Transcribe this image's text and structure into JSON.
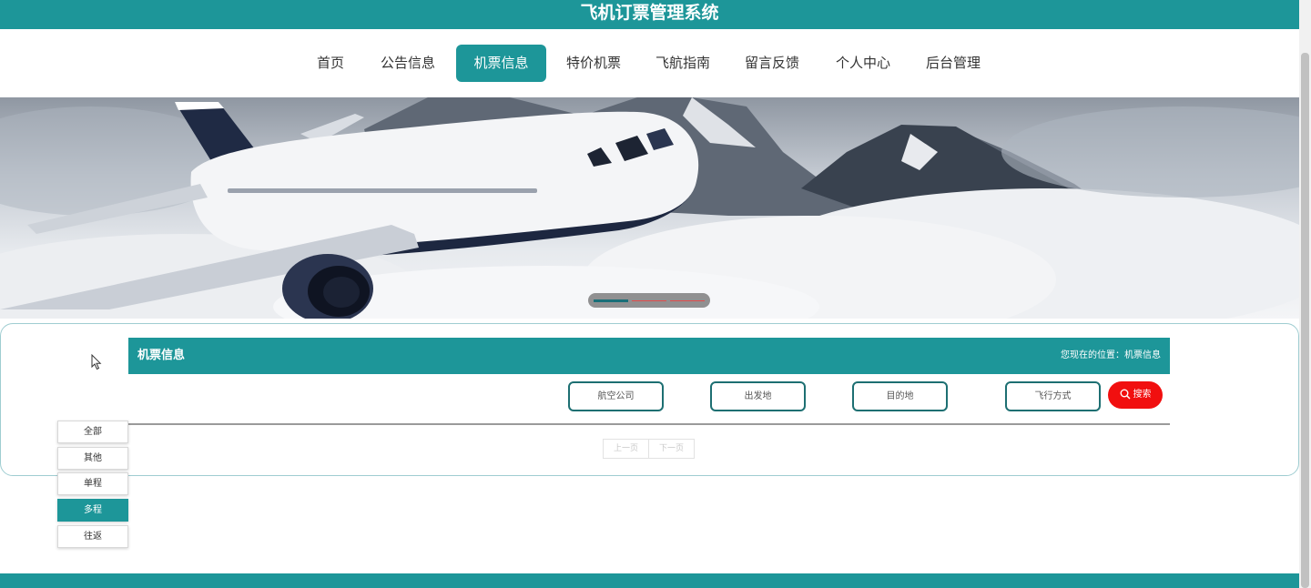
{
  "app": {
    "title": "飞机订票管理系统"
  },
  "nav": {
    "items": [
      {
        "label": "首页"
      },
      {
        "label": "公告信息"
      },
      {
        "label": "机票信息"
      },
      {
        "label": "特价机票"
      },
      {
        "label": "飞航指南"
      },
      {
        "label": "留言反馈"
      },
      {
        "label": "个人中心"
      },
      {
        "label": "后台管理"
      }
    ],
    "active": "机票信息"
  },
  "banner": {
    "slide_count": 3,
    "active_slide": 1
  },
  "section": {
    "title": "机票信息",
    "location_text": "您现在的位置：机票信息"
  },
  "filters": {
    "airline_placeholder": "航空公司",
    "origin_placeholder": "出发地",
    "destination_placeholder": "目的地",
    "flight_type_placeholder": "飞行方式",
    "search_label": "搜索"
  },
  "pagination": {
    "prev_label": "上一页",
    "next_label": "下一页"
  },
  "categories": {
    "items": [
      {
        "label": "全部"
      },
      {
        "label": "其他"
      },
      {
        "label": "单程"
      },
      {
        "label": "多程"
      },
      {
        "label": "往返"
      }
    ],
    "active": "多程"
  },
  "colors": {
    "primary": "#1d9699",
    "search": "#f10f0f",
    "footer": "#1d9699"
  }
}
